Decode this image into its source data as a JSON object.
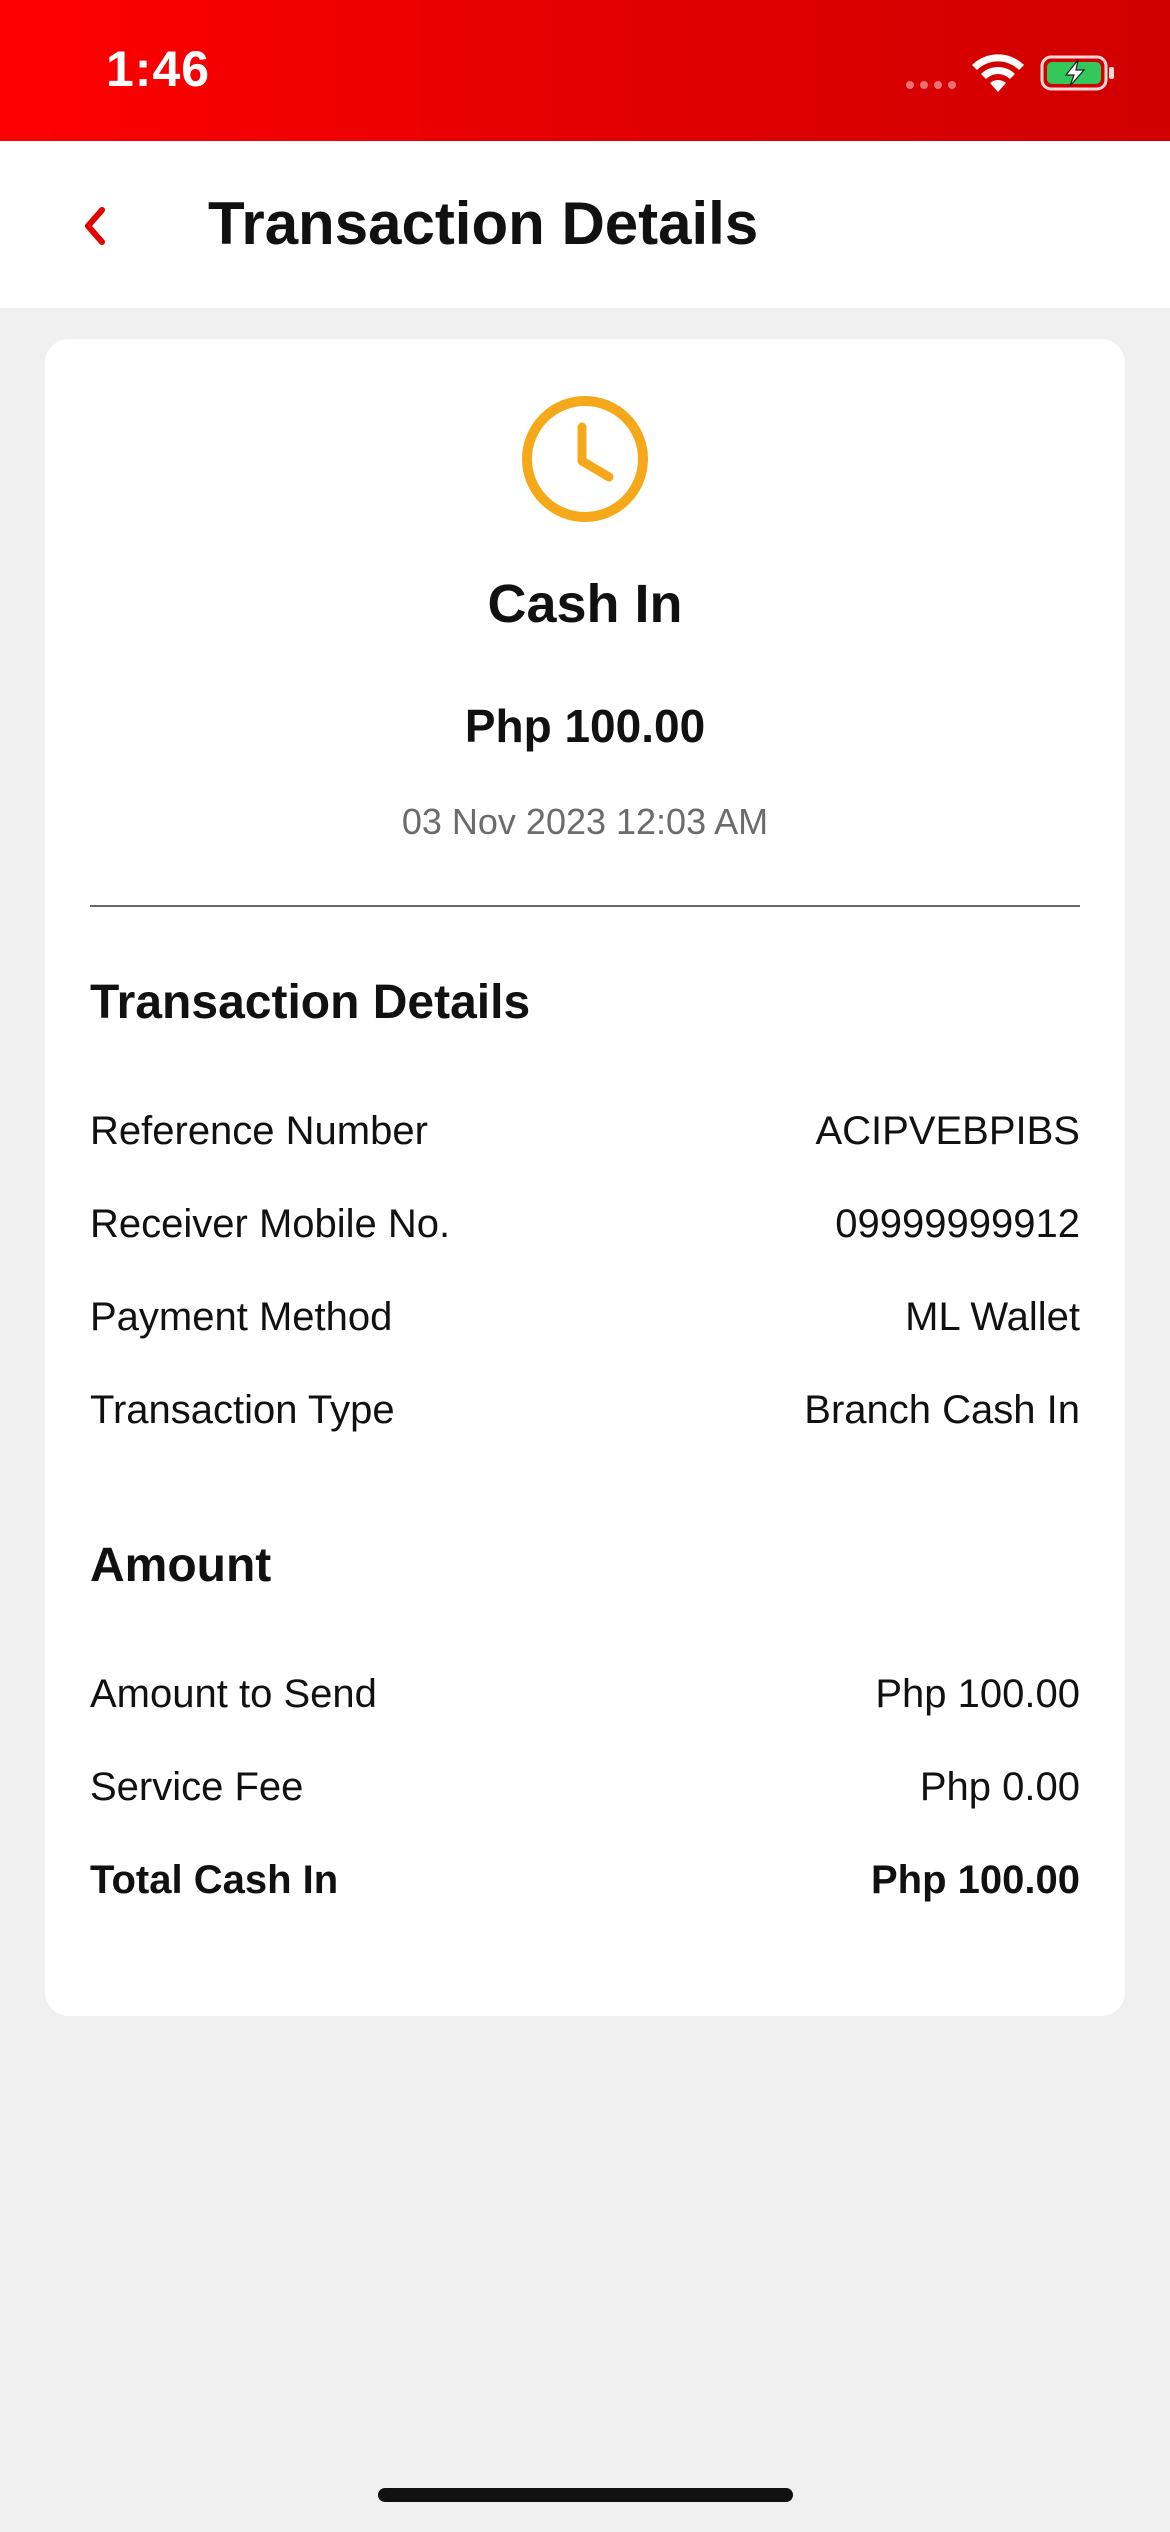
{
  "status_bar": {
    "time": "1:46"
  },
  "header": {
    "title": "Transaction Details",
    "back_icon": "chevron-left-icon"
  },
  "colors": {
    "accent_red": "#e10000",
    "status_icon_yellow": "#f5a91a",
    "battery_green": "#34c759",
    "background": "#f0f0f0"
  },
  "summary": {
    "status_icon": "clock-icon",
    "title": "Cash In",
    "amount": "Php 100.00",
    "date": "03 Nov 2023 12:03 AM"
  },
  "transaction_details": {
    "heading": "Transaction Details",
    "rows": [
      {
        "label": "Reference Number",
        "value": "ACIPVEBPIBS"
      },
      {
        "label": "Receiver Mobile No.",
        "value": "09999999912"
      },
      {
        "label": "Payment Method",
        "value": "ML Wallet"
      },
      {
        "label": "Transaction Type",
        "value": "Branch Cash In"
      }
    ]
  },
  "amount_section": {
    "heading": "Amount",
    "rows": [
      {
        "label": "Amount to Send",
        "value": "Php 100.00"
      },
      {
        "label": "Service Fee",
        "value": "Php 0.00"
      },
      {
        "label": "Total Cash In",
        "value": "Php 100.00"
      }
    ]
  }
}
